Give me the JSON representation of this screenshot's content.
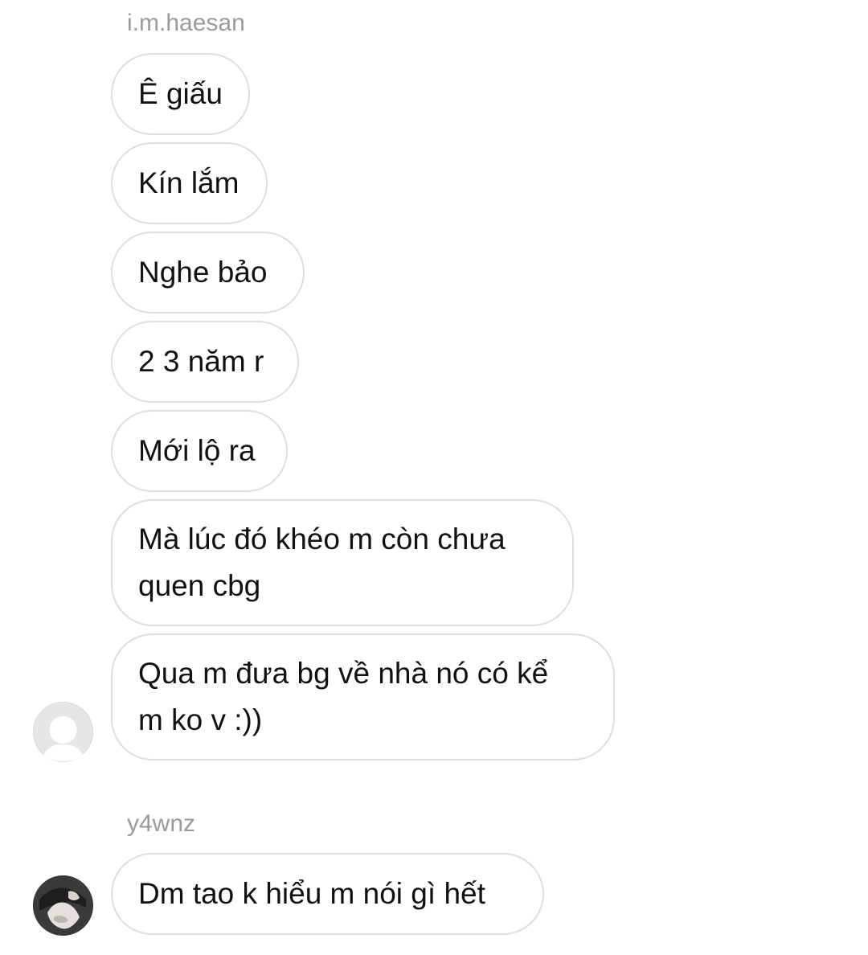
{
  "thread": {
    "groups": [
      {
        "sender": "i.m.haesan",
        "messages": [
          "Ê giấu",
          "Kín lắm",
          "Nghe bảo",
          "2 3 năm r",
          "Mới lộ ra",
          "Mà lúc đó khéo m còn chưa\nquen cbg",
          "Qua m đưa bg về nhà nó có kể\nm ko v :))"
        ],
        "avatar_icon": "default-profile-avatar-icon"
      },
      {
        "sender": "y4wnz",
        "messages": [
          "Dm tao k hiểu m nói gì hết"
        ],
        "avatar_icon": "profile-photo-avatar"
      }
    ]
  },
  "colors": {
    "background": "#ffffff",
    "bubble_border": "#dedede",
    "sender_text": "#9a9a9a",
    "message_text": "#111111"
  }
}
